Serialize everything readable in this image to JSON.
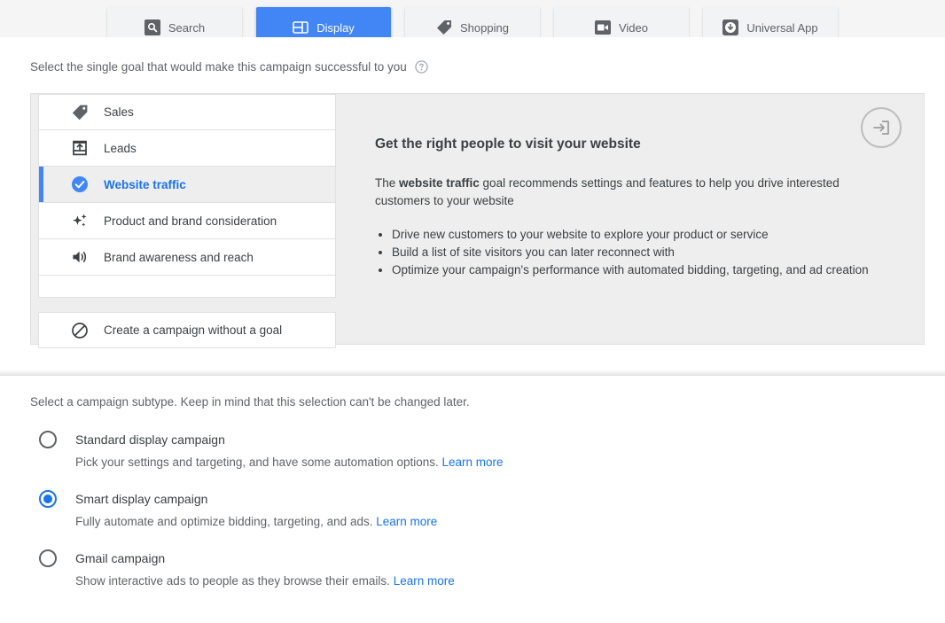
{
  "tabs": [
    {
      "label": "Search",
      "icon": "search-icon",
      "active": false
    },
    {
      "label": "Display",
      "icon": "display-layout-icon",
      "active": true
    },
    {
      "label": "Shopping",
      "icon": "price-tag-icon",
      "active": false
    },
    {
      "label": "Video",
      "icon": "video-camera-icon",
      "active": false
    },
    {
      "label": "Universal App",
      "icon": "circle-down-arrow-icon",
      "active": false
    }
  ],
  "goal": {
    "question": "Select the single goal that would make this campaign successful to you",
    "help_icon": "help-circle-icon",
    "items": [
      {
        "label": "Sales",
        "icon": "price-tag-icon",
        "selected": false
      },
      {
        "label": "Leads",
        "icon": "upload-box-icon",
        "selected": false
      },
      {
        "label": "Website traffic",
        "icon": "check-circle-icon",
        "selected": true
      },
      {
        "label": "Product and brand consideration",
        "icon": "sparkle-icon",
        "selected": false
      },
      {
        "label": "Brand awareness and reach",
        "icon": "speaker-volume-icon",
        "selected": false
      }
    ],
    "no_goal_item": {
      "label": "Create a campaign without a goal",
      "icon": "no-entry-icon"
    },
    "detail": {
      "badge_icon": "enter-box-arrow-icon",
      "title": "Get the right people to visit your website",
      "body_before": "The ",
      "body_bold": "website traffic",
      "body_after": " goal recommends settings and features to help you drive interested customers to your website",
      "bullets": [
        "Drive new customers to your website to explore your product or service",
        "Build a list of site visitors you can later reconnect with",
        "Optimize your campaign's performance with automated bidding, targeting, and ad creation"
      ]
    }
  },
  "subtype": {
    "intro": "Select a campaign subtype. Keep in mind that this selection can't be changed later.",
    "learn_more_label": "Learn more",
    "options": [
      {
        "label": "Standard display campaign",
        "description": "Pick your settings and targeting, and have some automation options.",
        "selected": false
      },
      {
        "label": "Smart display campaign",
        "description": "Fully automate and optimize bidding, targeting, and ads.",
        "selected": true
      },
      {
        "label": "Gmail campaign",
        "description": "Show interactive ads to people as they browse their emails.",
        "selected": false
      }
    ]
  },
  "colors": {
    "accent_blue": "#4285f4",
    "link_blue": "#1a73e8",
    "panel_gray": "#eeeeee",
    "text_gray": "#5f6368",
    "text_dark": "#3c4043"
  }
}
